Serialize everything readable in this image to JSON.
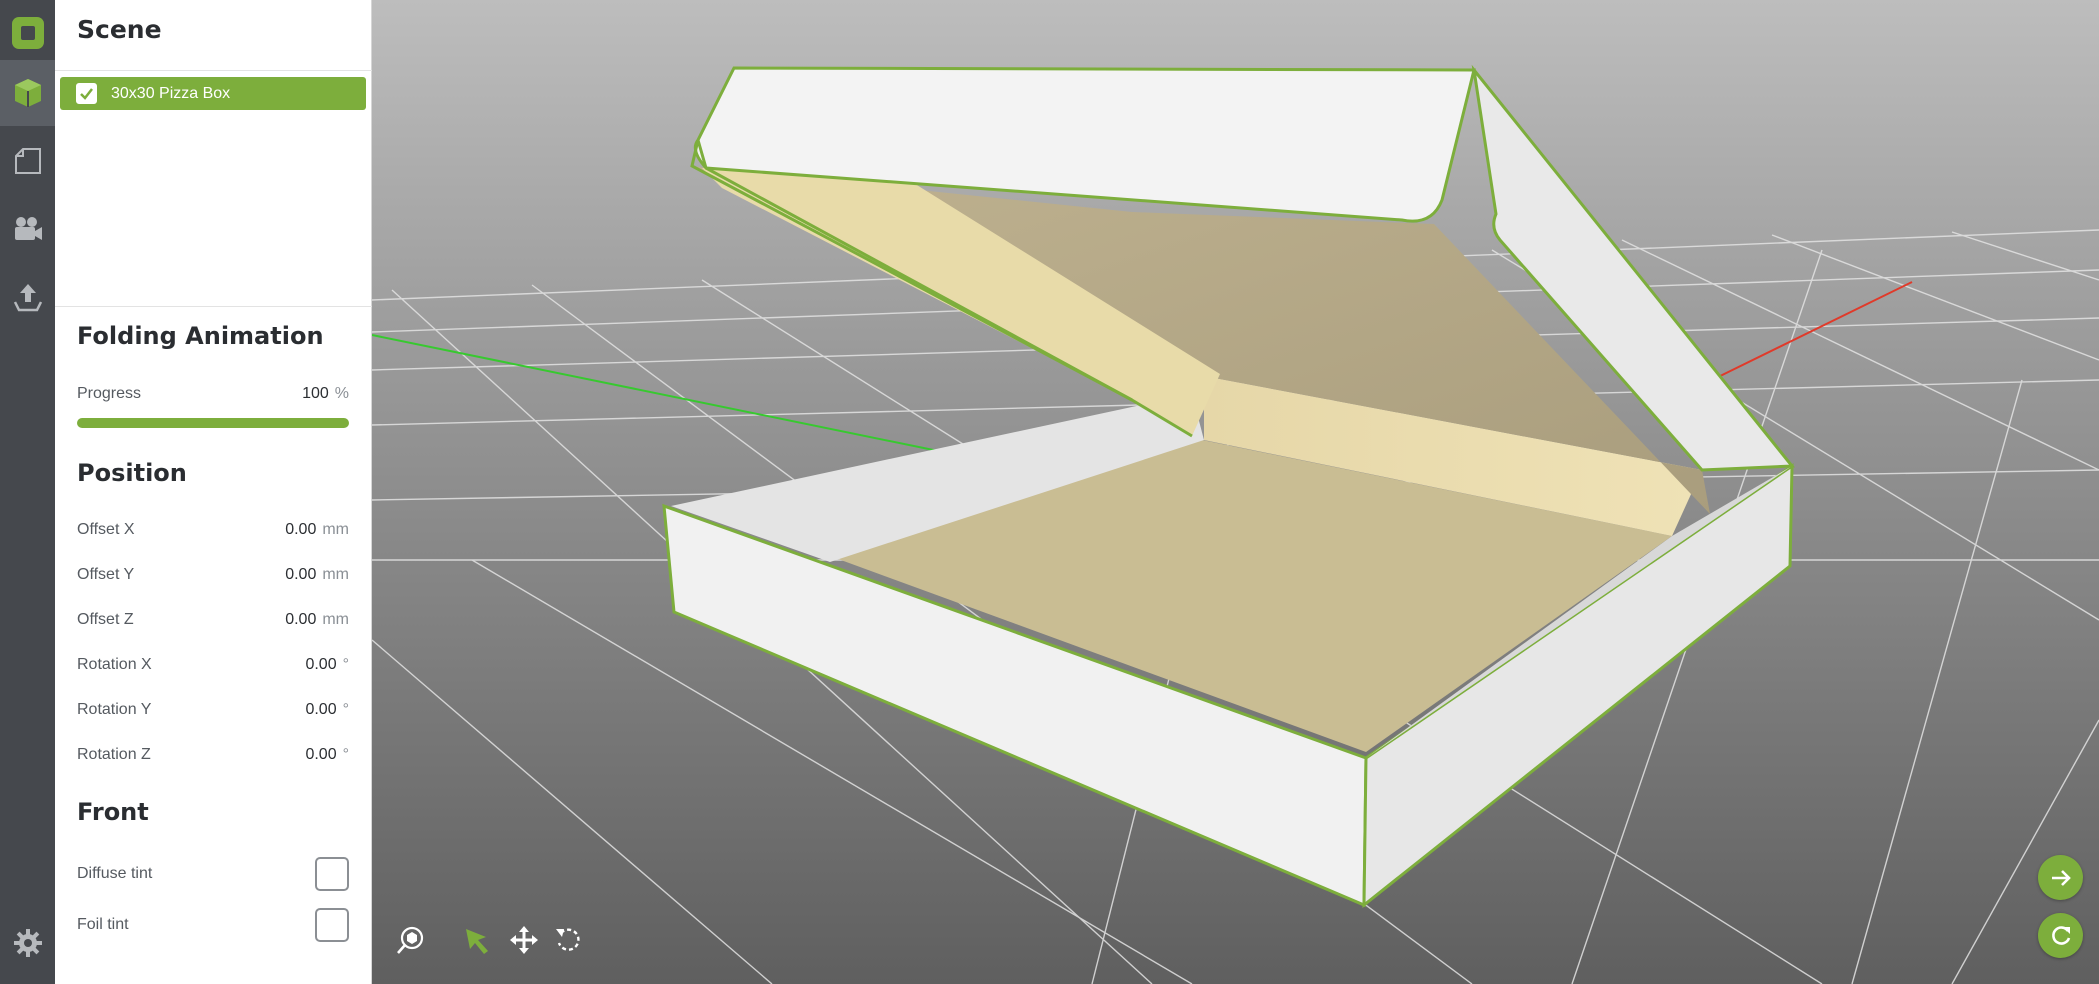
{
  "sidebar": {
    "items": [
      {
        "id": "logo",
        "icon": "app-logo-icon"
      },
      {
        "id": "model",
        "icon": "box-3d-icon",
        "active": true
      },
      {
        "id": "dieline",
        "icon": "flat-box-icon"
      },
      {
        "id": "camera",
        "icon": "video-camera-icon"
      },
      {
        "id": "export",
        "icon": "upload-icon"
      }
    ],
    "settings_icon": "gear-icon"
  },
  "panel": {
    "scene": {
      "title": "Scene",
      "items": [
        {
          "label": "30x30 Pizza Box",
          "checked": true
        }
      ]
    },
    "folding": {
      "title": "Folding Animation",
      "progress_label": "Progress",
      "progress_value": "100",
      "progress_unit": "%",
      "progress_fraction": 1.0
    },
    "position": {
      "title": "Position",
      "rows": [
        {
          "label": "Offset X",
          "value": "0.00",
          "unit": "mm"
        },
        {
          "label": "Offset Y",
          "value": "0.00",
          "unit": "mm"
        },
        {
          "label": "Offset Z",
          "value": "0.00",
          "unit": "mm"
        },
        {
          "label": "Rotation X",
          "value": "0.00",
          "unit": "°"
        },
        {
          "label": "Rotation Y",
          "value": "0.00",
          "unit": "°"
        },
        {
          "label": "Rotation Z",
          "value": "0.00",
          "unit": "°"
        }
      ]
    },
    "front": {
      "title": "Front",
      "diffuse_label": "Diffuse tint",
      "diffuse_checked": false,
      "foil_label": "Foil tint",
      "foil_checked": false
    }
  },
  "viewport": {
    "tools": [
      "zoom-fit-icon",
      "select-arrow-icon",
      "move-icon",
      "rotate-icon"
    ],
    "actions": [
      "next-arrow-icon",
      "refresh-icon"
    ],
    "colors": {
      "accent": "#7dae3c",
      "axis_x": "#e03a2a",
      "axis_z": "#37c92f",
      "box_inner": "#d8c99a",
      "box_outer": "#f0f0f0"
    }
  }
}
